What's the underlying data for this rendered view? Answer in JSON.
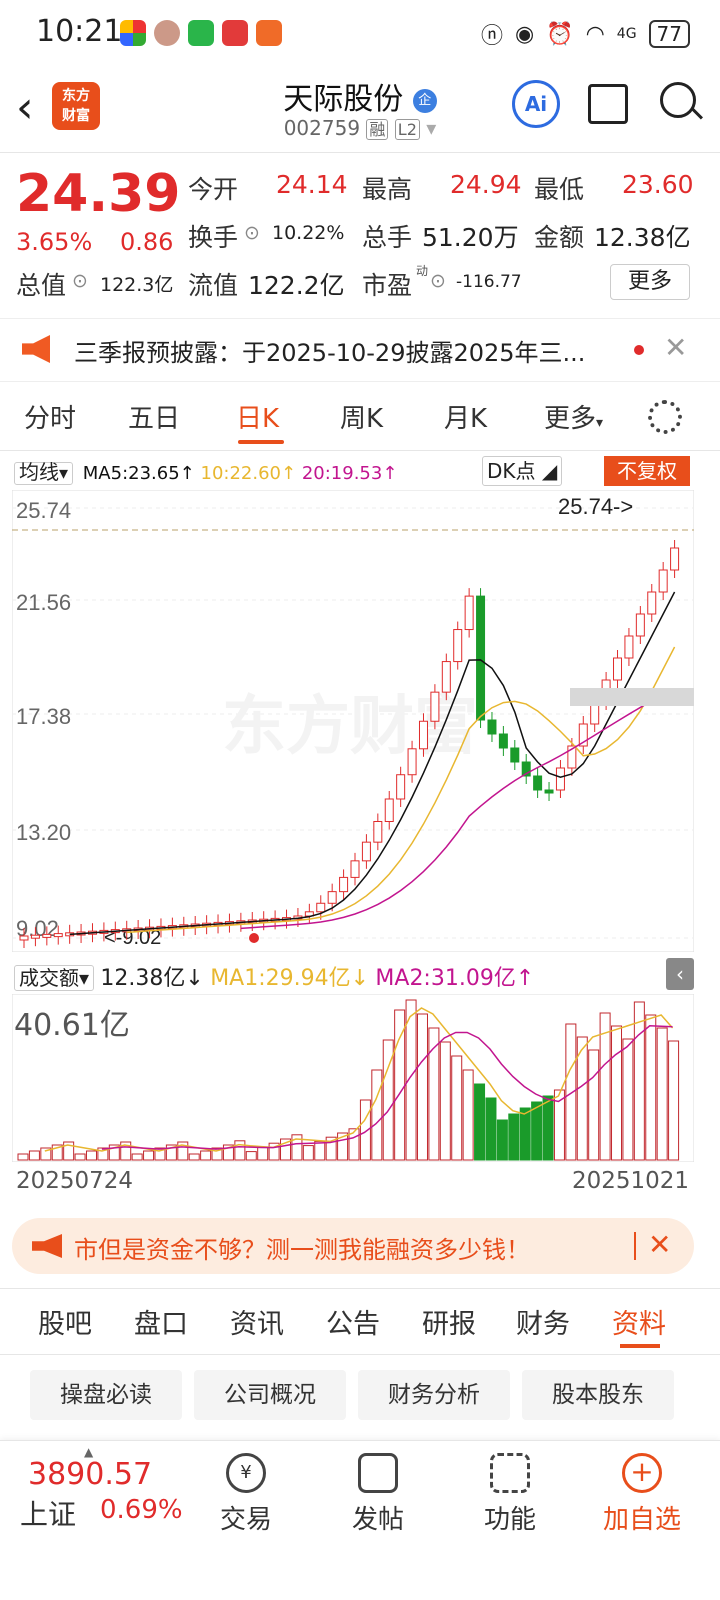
{
  "status": {
    "time": "10:21",
    "battery": "77",
    "signal": "4G"
  },
  "header": {
    "name": "天际股份",
    "code": "002759",
    "margin_tag": "融",
    "level": "L2",
    "logo_line1": "东方",
    "logo_line2": "财富",
    "ai_label": "Ai"
  },
  "quote": {
    "price": "24.39",
    "pct": "3.65%",
    "chg": "0.86",
    "open_l": "今开",
    "open_v": "24.14",
    "high_l": "最高",
    "high_v": "24.94",
    "low_l": "最低",
    "low_v": "23.60",
    "turnover_l": "换手",
    "turnover_v": "10.22%",
    "vol_l": "总手",
    "vol_v": "51.20万",
    "amount_l": "金额",
    "amount_v": "12.38亿",
    "mcap_l": "总值",
    "mcap_v": "122.3亿",
    "float_l": "流值",
    "float_v": "122.2亿",
    "pe_l": "市盈",
    "pe_sup": "动",
    "pe_v": "-116.77",
    "more_label": "更多"
  },
  "notice": {
    "text": "三季报预披露：于2025-10-29披露2025年三..."
  },
  "ktabs": [
    "分时",
    "五日",
    "日K",
    "周K",
    "月K",
    "更多"
  ],
  "ma": {
    "label": "均线",
    "ma5": "MA5:23.65↑",
    "ma10": "10:22.60↑",
    "ma20": "20:19.53↑",
    "dk": "DK点",
    "fq": "不复权"
  },
  "kline": {
    "y_labels": [
      "25.74",
      "21.56",
      "17.38",
      "13.20",
      "9.02"
    ],
    "max_marker": "25.74->",
    "min_marker": "<-9.02",
    "watermark": "东方财富"
  },
  "volume": {
    "label": "成交额",
    "value": "12.38亿↓",
    "ma1": "MA1:29.94亿↓",
    "ma2": "MA2:31.09亿↑",
    "max": "40.61亿",
    "date_start": "20250724",
    "date_end": "20251021"
  },
  "ad": {
    "text": "市但是资金不够？测一测我能融资多少钱！"
  },
  "btabs": [
    "股吧",
    "盘口",
    "资讯",
    "公告",
    "研报",
    "财务",
    "资料"
  ],
  "chips": [
    "操盘必读",
    "公司概况",
    "财务分析",
    "股本股东"
  ],
  "footer": {
    "index_value": "3890.57",
    "index_name": "上证",
    "index_pct": "0.69%",
    "items": [
      "交易",
      "发帖",
      "功能",
      "加自选"
    ]
  },
  "colors": {
    "up": "#e02b2b",
    "down": "#1a9b2a",
    "accent": "#e84e1b",
    "ma5": "#111111",
    "ma10": "#e8b730",
    "ma20": "#c2158f"
  }
}
